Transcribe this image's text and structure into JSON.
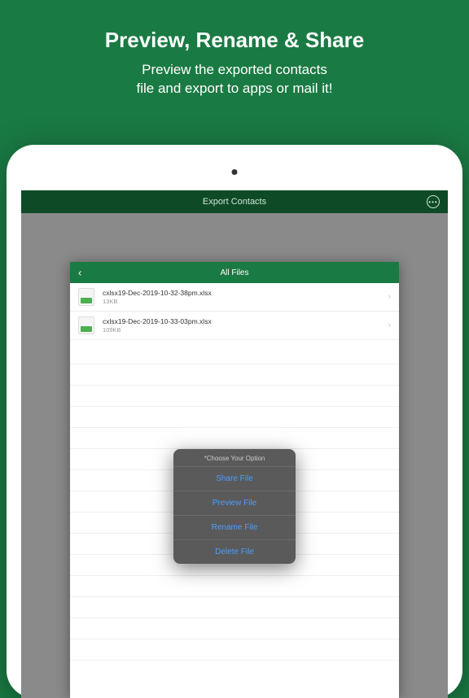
{
  "hero": {
    "title": "Preview, Rename & Share",
    "subtitle_line1": "Preview the exported contacts",
    "subtitle_line2": "file and export to apps or mail it!"
  },
  "top_bar": {
    "title": "Export Contacts"
  },
  "card": {
    "header_title": "All Files",
    "files": [
      {
        "name": "cxlsx19-Dec-2019-10-32-38pm.xlsx",
        "size": "13KB"
      },
      {
        "name": "cxlsx19-Dec-2019-10-33-03pm.xlsx",
        "size": "109KB"
      }
    ]
  },
  "popup": {
    "title": "*Choose Your Option",
    "options": [
      "Share File",
      "Preview File",
      "Rename File",
      "Delete File"
    ]
  }
}
